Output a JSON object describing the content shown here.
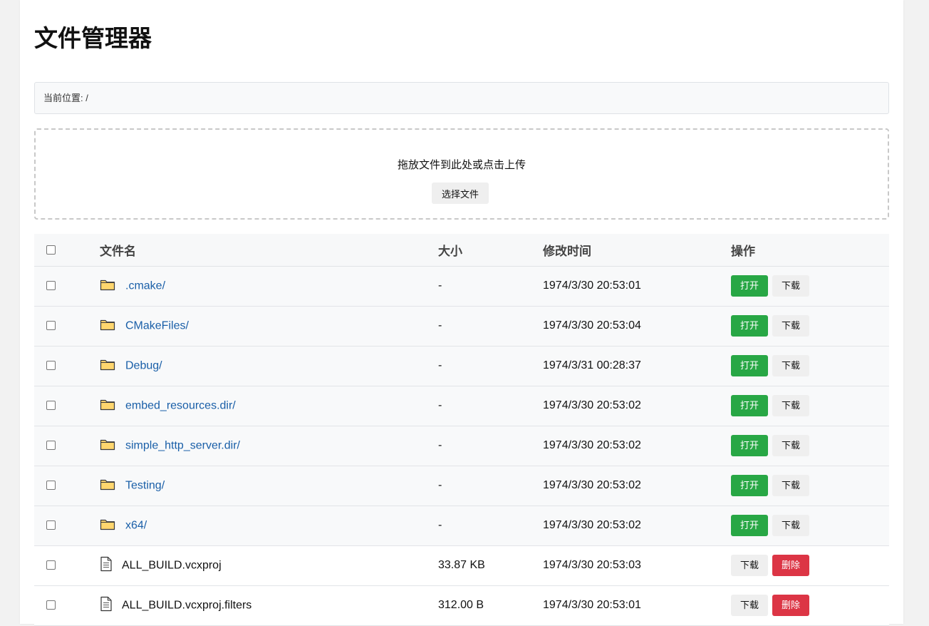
{
  "page": {
    "title": "文件管理器"
  },
  "breadcrumb": {
    "text": "当前位置: /"
  },
  "upload": {
    "hint": "拖放文件到此处或点击上传",
    "choose_label": "选择文件"
  },
  "table": {
    "headers": {
      "name": "文件名",
      "size": "大小",
      "modified": "修改时间",
      "actions": "操作"
    },
    "rows": [
      {
        "type": "dir",
        "name": ".cmake/",
        "size": "-",
        "modified": "1974/3/30 20:53:01",
        "actions": [
          "打开",
          "下载"
        ]
      },
      {
        "type": "dir",
        "name": "CMakeFiles/",
        "size": "-",
        "modified": "1974/3/30 20:53:04",
        "actions": [
          "打开",
          "下载"
        ]
      },
      {
        "type": "dir",
        "name": "Debug/",
        "size": "-",
        "modified": "1974/3/31 00:28:37",
        "actions": [
          "打开",
          "下载"
        ]
      },
      {
        "type": "dir",
        "name": "embed_resources.dir/",
        "size": "-",
        "modified": "1974/3/30 20:53:02",
        "actions": [
          "打开",
          "下载"
        ]
      },
      {
        "type": "dir",
        "name": "simple_http_server.dir/",
        "size": "-",
        "modified": "1974/3/30 20:53:02",
        "actions": [
          "打开",
          "下载"
        ]
      },
      {
        "type": "dir",
        "name": "Testing/",
        "size": "-",
        "modified": "1974/3/30 20:53:02",
        "actions": [
          "打开",
          "下载"
        ]
      },
      {
        "type": "dir",
        "name": "x64/",
        "size": "-",
        "modified": "1974/3/30 20:53:02",
        "actions": [
          "打开",
          "下载"
        ]
      },
      {
        "type": "file",
        "name": "ALL_BUILD.vcxproj",
        "size": "33.87 KB",
        "modified": "1974/3/30 20:53:03",
        "actions": [
          "下载",
          "删除"
        ]
      },
      {
        "type": "file",
        "name": "ALL_BUILD.vcxproj.filters",
        "size": "312.00 B",
        "modified": "1974/3/30 20:53:01",
        "actions": [
          "下载",
          "删除"
        ]
      }
    ]
  },
  "colors": {
    "open": "#28a745",
    "delete": "#dc3545",
    "link": "#1a5fa8",
    "folder": "#ffd66e"
  },
  "icons": {
    "dir": "folder-icon",
    "file": "file-icon"
  }
}
